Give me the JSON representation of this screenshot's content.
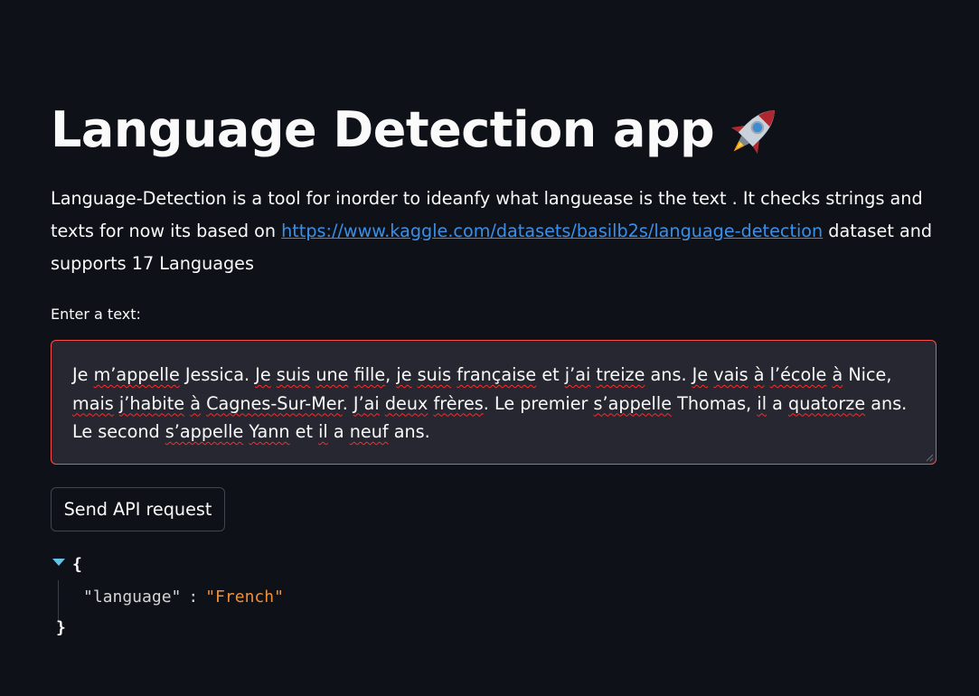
{
  "title": "Language Detection app",
  "title_icon": "rocket-icon",
  "description": {
    "before_link": "Language-Detection is a tool for inorder to ideanfy what languease is the text . It checks strings and texts for now its based on ",
    "link_text": "https://www.kaggle.com/datasets/basilb2s/language-detection",
    "after_link": " dataset and supports 17 Languages"
  },
  "input": {
    "label": "Enter a text:",
    "value": "Je m’appelle Jessica. Je suis une fille, je suis française et j’ai treize ans. Je vais à l’école à Nice, mais j’habite à Cagnes-Sur-Mer. J’ai deux frères. Le premier s’appelle Thomas, il a quatorze ans. Le second s’appelle Yann et il a neuf ans.",
    "segments": [
      {
        "t": "Je ",
        "s": false
      },
      {
        "t": "m’appelle",
        "s": true
      },
      {
        "t": " Jessica. ",
        "s": false
      },
      {
        "t": "Je",
        "s": true
      },
      {
        "t": " ",
        "s": false
      },
      {
        "t": "suis",
        "s": true
      },
      {
        "t": " ",
        "s": false
      },
      {
        "t": "une",
        "s": true
      },
      {
        "t": " ",
        "s": false
      },
      {
        "t": "fille",
        "s": true
      },
      {
        "t": ", ",
        "s": false
      },
      {
        "t": "je",
        "s": true
      },
      {
        "t": " ",
        "s": false
      },
      {
        "t": "suis",
        "s": true
      },
      {
        "t": " ",
        "s": false
      },
      {
        "t": "française",
        "s": true
      },
      {
        "t": " et ",
        "s": false
      },
      {
        "t": "j’ai",
        "s": true
      },
      {
        "t": " ",
        "s": false
      },
      {
        "t": "treize",
        "s": true
      },
      {
        "t": " ans. ",
        "s": false
      },
      {
        "t": "Je",
        "s": true
      },
      {
        "t": " ",
        "s": false
      },
      {
        "t": "vais",
        "s": true
      },
      {
        "t": " ",
        "s": false
      },
      {
        "t": "à",
        "s": true
      },
      {
        "t": " ",
        "s": false
      },
      {
        "t": "l’école",
        "s": true
      },
      {
        "t": " ",
        "s": false
      },
      {
        "t": "à",
        "s": true
      },
      {
        "t": " Nice, ",
        "s": false
      },
      {
        "t": "mais",
        "s": true
      },
      {
        "t": " ",
        "s": false
      },
      {
        "t": "j’habite",
        "s": true
      },
      {
        "t": " ",
        "s": false
      },
      {
        "t": "à",
        "s": true
      },
      {
        "t": " ",
        "s": false
      },
      {
        "t": "Cagnes-Sur-Mer",
        "s": true
      },
      {
        "t": ". ",
        "s": false
      },
      {
        "t": "J’ai",
        "s": true
      },
      {
        "t": " ",
        "s": false
      },
      {
        "t": "deux",
        "s": true
      },
      {
        "t": " ",
        "s": false
      },
      {
        "t": "frères",
        "s": true
      },
      {
        "t": ". Le premier ",
        "s": false
      },
      {
        "t": "s’appelle",
        "s": true
      },
      {
        "t": " Thomas, ",
        "s": false
      },
      {
        "t": "il",
        "s": true
      },
      {
        "t": " a ",
        "s": false
      },
      {
        "t": "quatorze",
        "s": true
      },
      {
        "t": " ans. Le second ",
        "s": false
      },
      {
        "t": "s’appelle",
        "s": true
      },
      {
        "t": " ",
        "s": false
      },
      {
        "t": "Yann",
        "s": true
      },
      {
        "t": " et ",
        "s": false
      },
      {
        "t": "il",
        "s": true
      },
      {
        "t": " a ",
        "s": false
      },
      {
        "t": "neuf",
        "s": true
      },
      {
        "t": " ans.",
        "s": false
      }
    ],
    "border_color": "#ff4b4b",
    "spellcheck_color": "#ff2a2a"
  },
  "button": {
    "label": "Send API request"
  },
  "response": {
    "toggle_icon": "triangle-down-icon",
    "open_brace": "{",
    "close_brace": "}",
    "key": "\"language\"",
    "colon": ":",
    "value": "\"French\""
  },
  "colors": {
    "background": "#0e1117",
    "link": "#3a90e8",
    "json_value": "#f0903a",
    "toggle": "#66c2e6"
  }
}
